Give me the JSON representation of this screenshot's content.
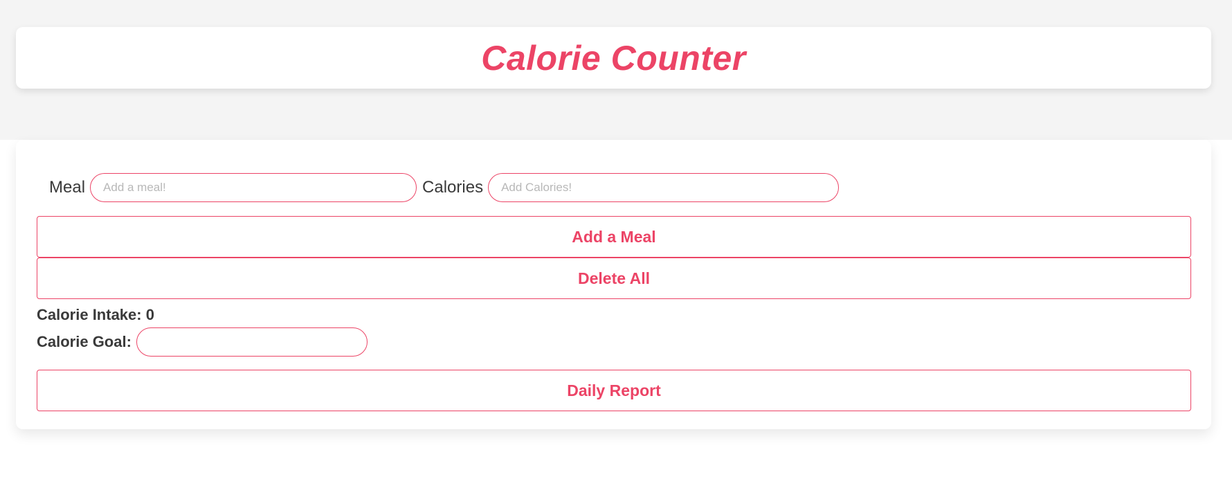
{
  "header": {
    "title": "Calorie Counter"
  },
  "form": {
    "meal_label": "Meal",
    "meal_placeholder": "Add a meal!",
    "meal_value": "",
    "calories_label": "Calories",
    "calories_placeholder": "Add Calories!",
    "calories_value": ""
  },
  "actions": {
    "add_meal_label": "Add a Meal",
    "delete_all_label": "Delete All",
    "daily_report_label": "Daily Report"
  },
  "stats": {
    "intake_label": "Calorie Intake:",
    "intake_value": "0",
    "goal_label": "Calorie Goal:",
    "goal_value": ""
  },
  "colors": {
    "accent": "#ec4466",
    "background_band": "#f4f4f4",
    "text": "#3a3a3a"
  }
}
